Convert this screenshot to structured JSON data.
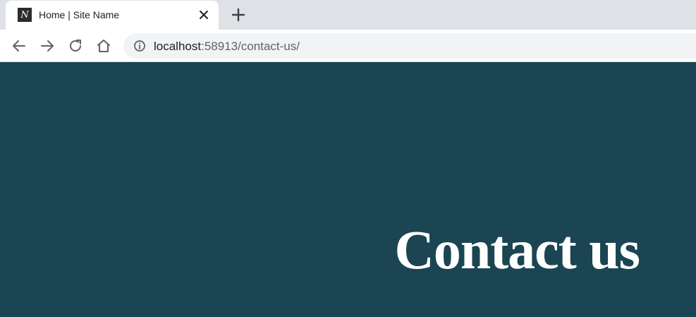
{
  "browser": {
    "tab": {
      "title": "Home | Site Name",
      "favicon_letter": "N"
    },
    "address_bar": {
      "host": "localhost",
      "rest": ":58913/contact-us/"
    },
    "nav_icons": [
      "back-arrow-icon",
      "forward-arrow-icon",
      "reload-icon",
      "home-icon"
    ]
  },
  "page": {
    "hero_title": "Contact us"
  },
  "colors": {
    "hero_background": "#1b4552",
    "tabstrip": "#dee1e6",
    "omnibox": "#f1f3f4"
  }
}
